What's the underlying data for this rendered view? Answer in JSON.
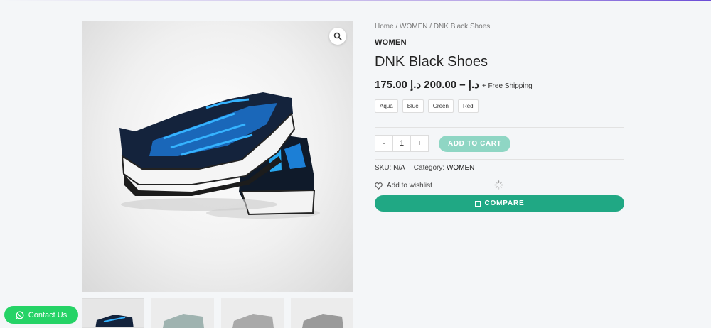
{
  "breadcrumb": {
    "home": "Home",
    "sep1": " / ",
    "category": "WOMEN",
    "sep2": " / ",
    "current": "DNK Black Shoes"
  },
  "product": {
    "category_tag": "WOMEN",
    "title": "DNK Black Shoes",
    "price": "175.00 د.إ – 200.00 د.إ",
    "shipping": "+ Free Shipping",
    "colors": [
      "Aqua",
      "Blue",
      "Green",
      "Red"
    ],
    "quantity": "1",
    "minus": "-",
    "plus": "+",
    "add_to_cart": "ADD TO CART",
    "sku_label": "SKU:",
    "sku_value": "N/A",
    "category_label": "Category:",
    "category_value": "WOMEN",
    "wishlist": "Add to wishlist",
    "compare": "COMPARE"
  },
  "contact": {
    "label": "Contact Us"
  },
  "icons": {
    "zoom": "magnifier-icon",
    "wishlist": "heart-icon",
    "compare": "square-icon",
    "contact": "whatsapp-icon",
    "loading": "spinner-icon"
  },
  "colors": {
    "primary": "#20a884",
    "add_to_cart": "#8fd6c4",
    "whatsapp": "#25d366"
  }
}
